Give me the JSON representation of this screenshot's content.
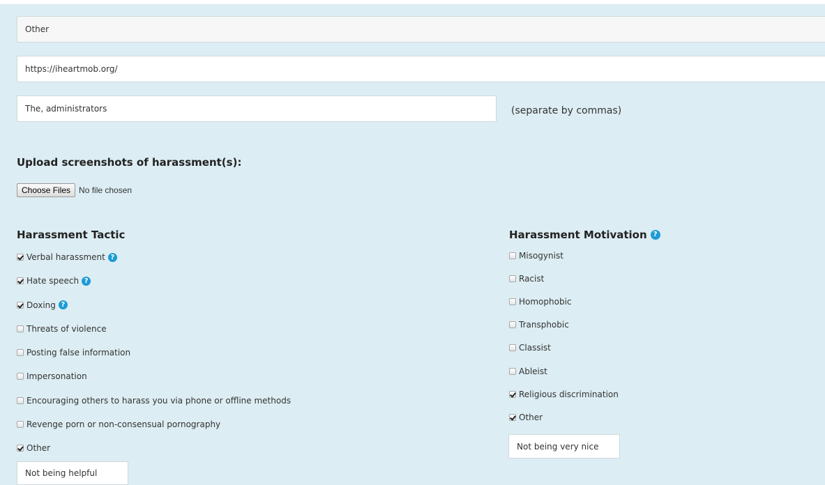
{
  "form": {
    "type_value": "Other",
    "url_value": "https://iheartmob.org/",
    "handles_value": "The, administrators",
    "handles_hint": "(separate by commas)",
    "upload_heading": "Upload screenshots of harassment(s):",
    "choose_files_label": "Choose Files",
    "file_status": "No file chosen"
  },
  "tactic": {
    "heading": "Harassment Tactic",
    "items": [
      {
        "label": "Verbal harassment",
        "checked": true,
        "help": true
      },
      {
        "label": "Hate speech",
        "checked": true,
        "help": true
      },
      {
        "label": "Doxing",
        "checked": true,
        "help": true
      },
      {
        "label": "Threats of violence",
        "checked": false,
        "help": false
      },
      {
        "label": "Posting false information",
        "checked": false,
        "help": false
      },
      {
        "label": "Impersonation",
        "checked": false,
        "help": false
      },
      {
        "label": "Encouraging others to harass you via phone or offline methods",
        "checked": false,
        "help": false
      },
      {
        "label": "Revenge porn or non-consensual pornography",
        "checked": false,
        "help": false
      },
      {
        "label": "Other",
        "checked": true,
        "help": false
      }
    ],
    "other_value": "Not being helpful"
  },
  "motivation": {
    "heading": "Harassment Motivation",
    "items": [
      {
        "label": "Misogynist",
        "checked": false
      },
      {
        "label": "Racist",
        "checked": false
      },
      {
        "label": "Homophobic",
        "checked": false
      },
      {
        "label": "Transphobic",
        "checked": false
      },
      {
        "label": "Classist",
        "checked": false
      },
      {
        "label": "Ableist",
        "checked": false
      },
      {
        "label": "Religious discrimination",
        "checked": true
      },
      {
        "label": "Other",
        "checked": true
      }
    ],
    "other_value": "Not being very nice"
  },
  "icons": {
    "help": "question-circle-icon",
    "help_glyph": "?"
  },
  "colors": {
    "panel_bg": "#dcedf3",
    "help_icon": "#1d9bd6"
  }
}
